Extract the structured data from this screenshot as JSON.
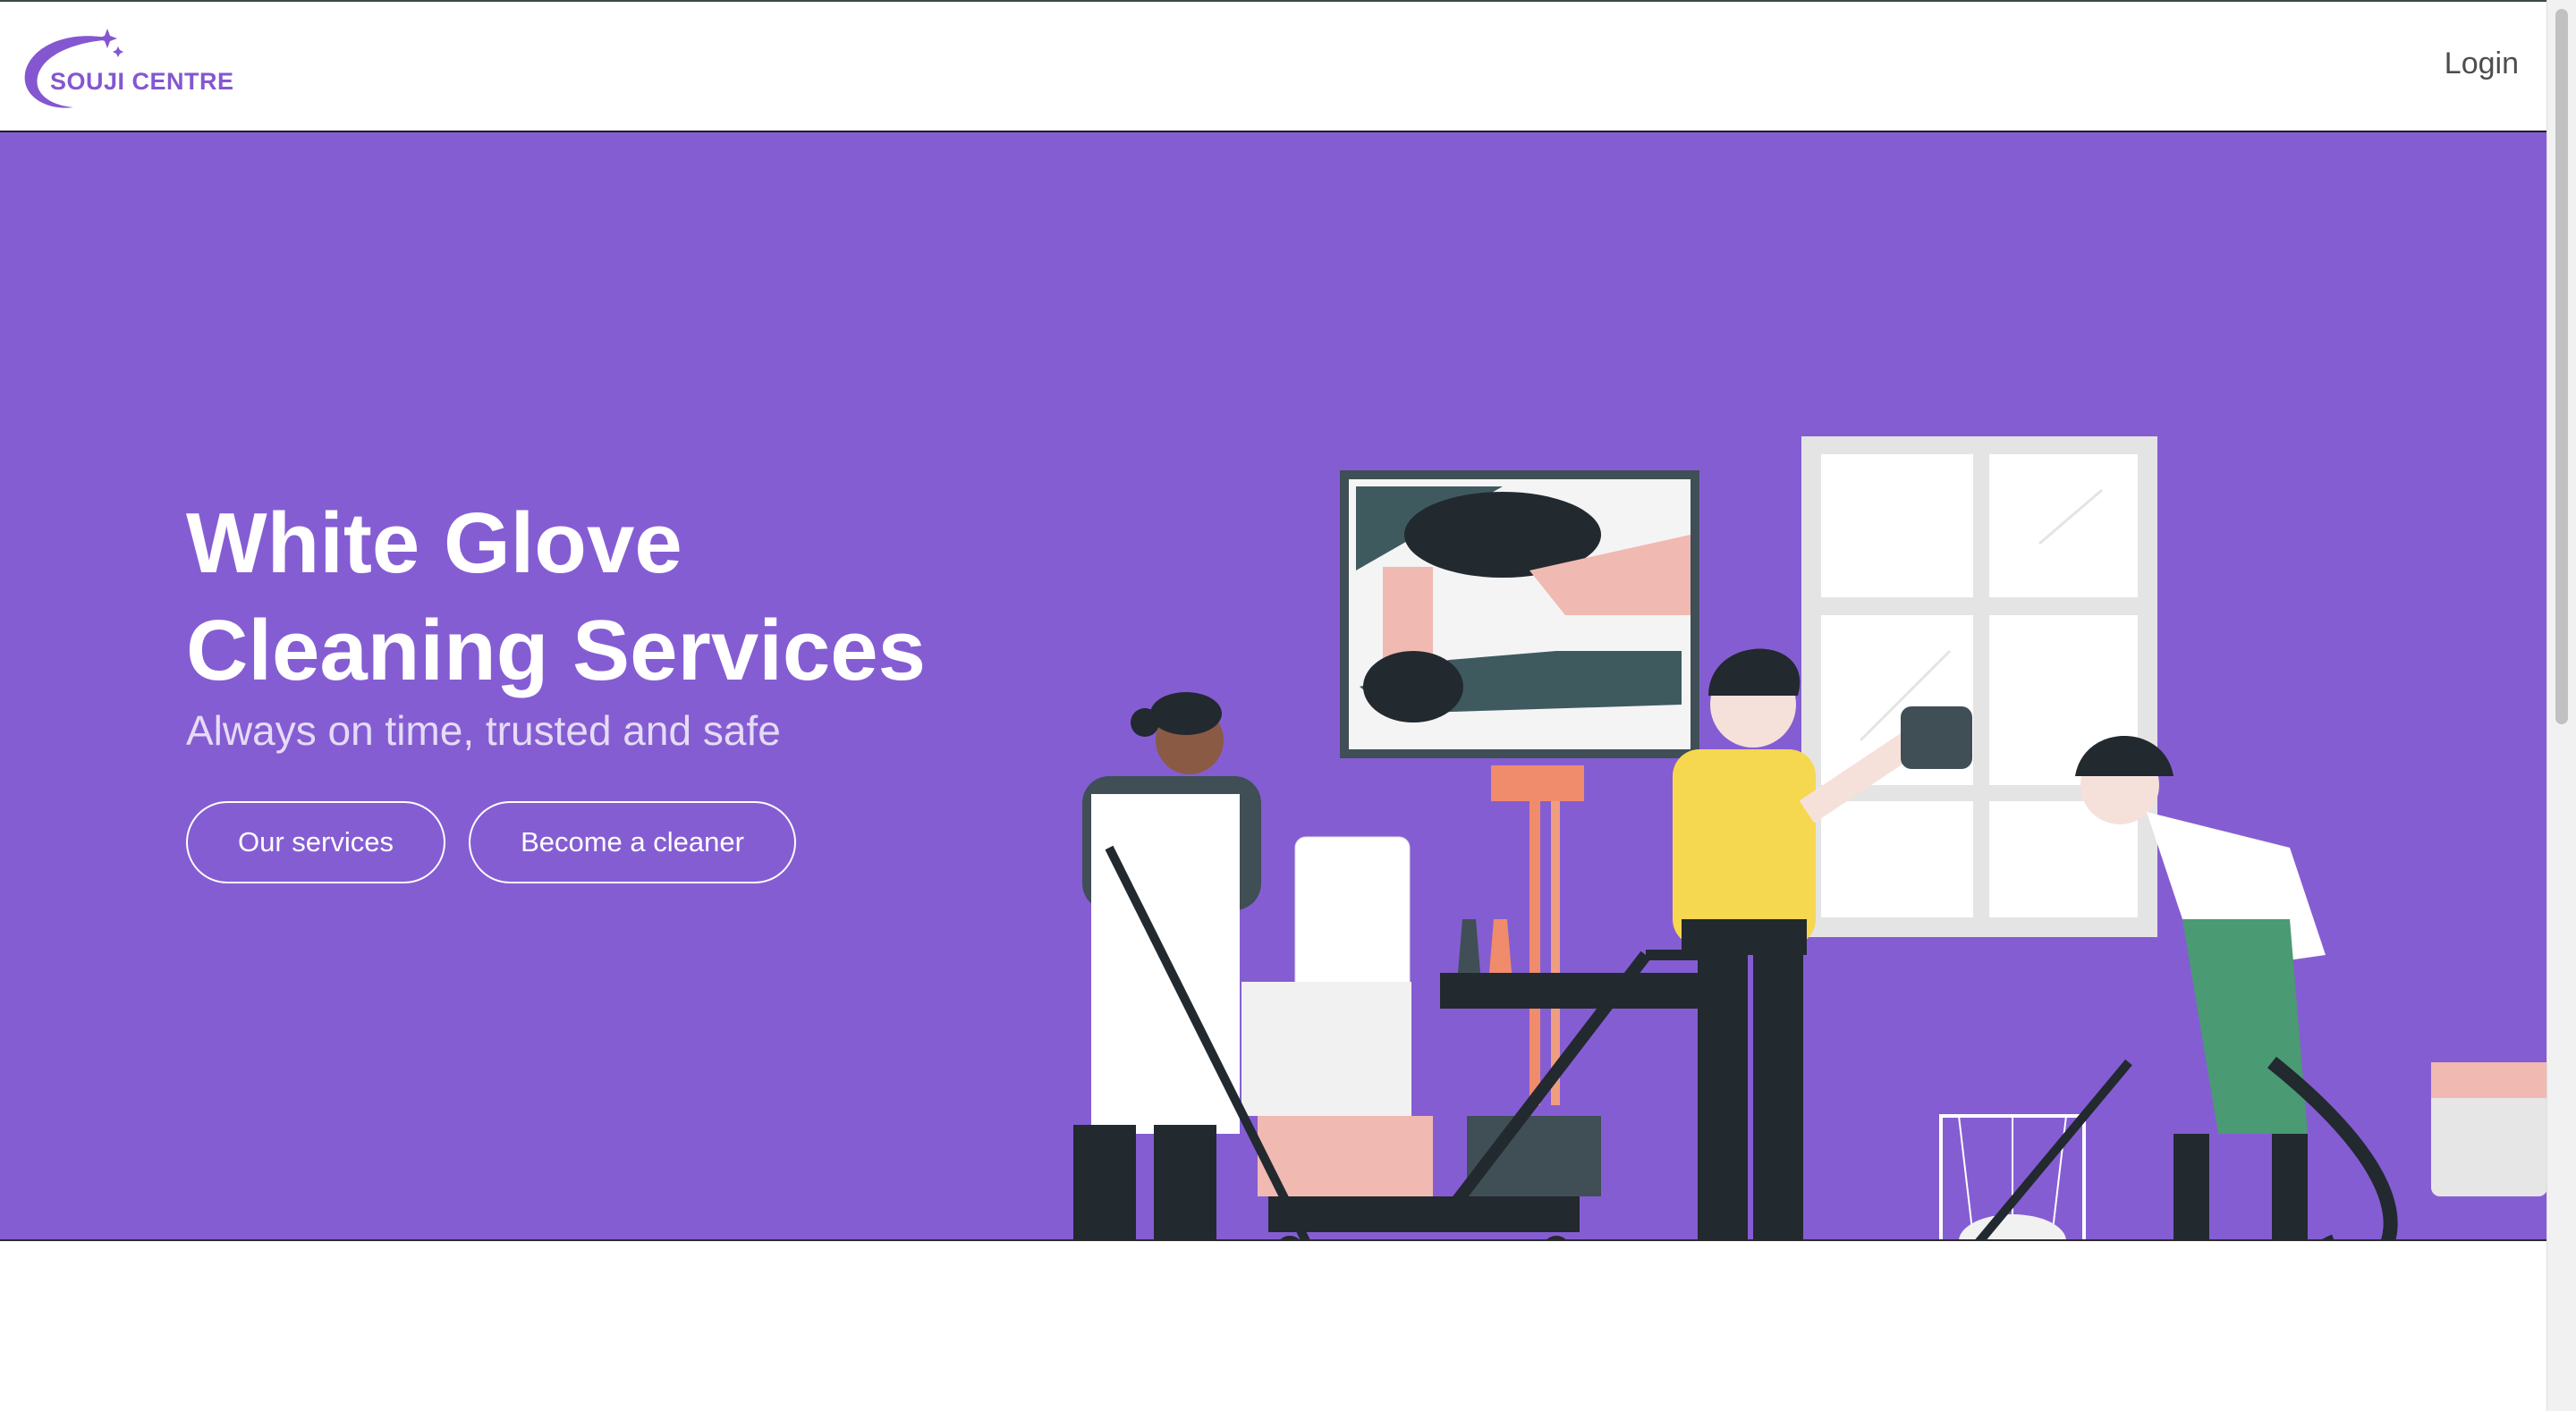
{
  "header": {
    "logo_text": "SOUJI CENTRE",
    "login_label": "Login"
  },
  "hero": {
    "title_line1": "White Glove",
    "title_line2": "Cleaning Services",
    "subtitle": "Always on time, trusted and safe",
    "primary_button": "Our services",
    "secondary_button": "Become a cleaner"
  },
  "colors": {
    "brand_purple": "#855dd3",
    "logo_purple": "#8457d0",
    "white": "#ffffff"
  },
  "icons": {
    "logo": "sparkle-swoosh-logo-icon"
  }
}
